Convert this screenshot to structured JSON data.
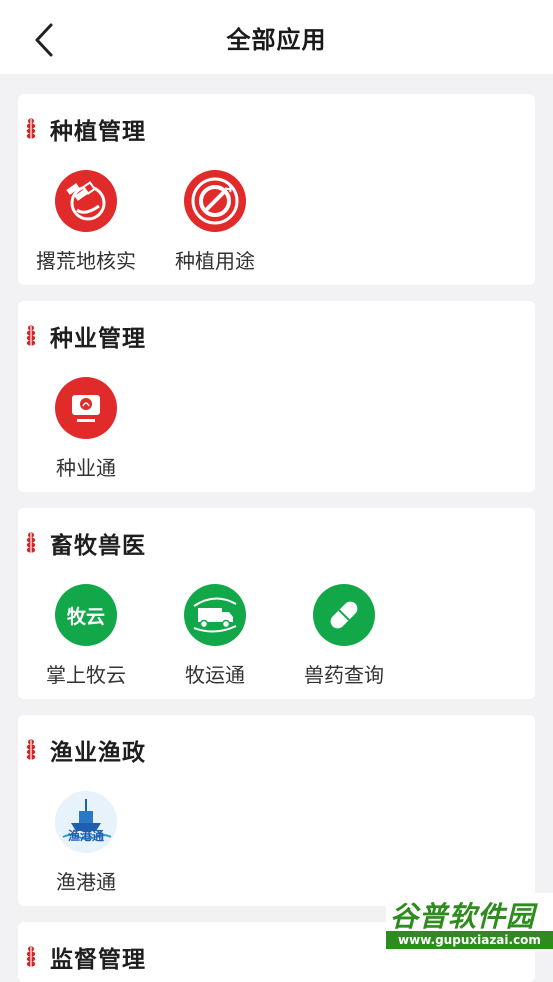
{
  "header": {
    "title": "全部应用"
  },
  "sections": [
    {
      "title": "种植管理",
      "apps": [
        {
          "label": "撂荒地核实",
          "icon": "satellite-globe-icon"
        },
        {
          "label": "种植用途",
          "icon": "no-grain-icon"
        }
      ]
    },
    {
      "title": "种业管理",
      "apps": [
        {
          "label": "种业通",
          "icon": "seedling-monitor-icon"
        }
      ]
    },
    {
      "title": "畜牧兽医",
      "apps": [
        {
          "label": "掌上牧云",
          "icon": "muyun-logo-icon",
          "icon_text": "牧云"
        },
        {
          "label": "牧运通",
          "icon": "livestock-truck-icon"
        },
        {
          "label": "兽药查询",
          "icon": "capsule-pill-icon"
        }
      ]
    },
    {
      "title": "渔业渔政",
      "apps": [
        {
          "label": "渔港通",
          "icon": "fishing-ship-icon",
          "icon_text": "渔港通"
        }
      ]
    },
    {
      "title": "监督管理",
      "apps": []
    }
  ],
  "watermark": {
    "logo": "谷普软件园",
    "url": "www.gupuxiazai.com"
  },
  "colors": {
    "accent_red": "#e12a2a",
    "accent_green": "#12a84a",
    "background": "#f2f2f4"
  }
}
